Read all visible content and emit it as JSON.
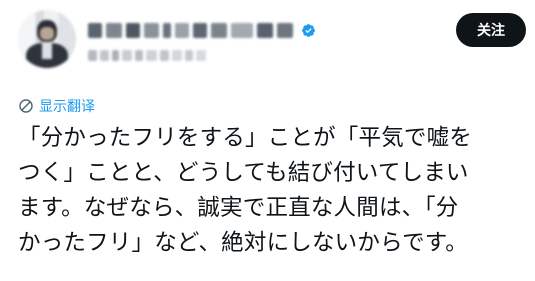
{
  "post": {
    "follow_label": "关注",
    "translate_label": "显示翻译",
    "text": "「分かったフリをする」ことが「平気で嘘を\nつく」ことと、どうしても結び付いてしまい\nます。なぜなら、誠実で正直な人間は、「分\nかったフリ」など、絶対にしないからです。"
  },
  "colors": {
    "accent": "#1d9bf0",
    "button_bg": "#0f1419",
    "text": "#0f1419"
  },
  "icons": {
    "verified": "verified-badge-icon",
    "translate": "globe-icon"
  }
}
